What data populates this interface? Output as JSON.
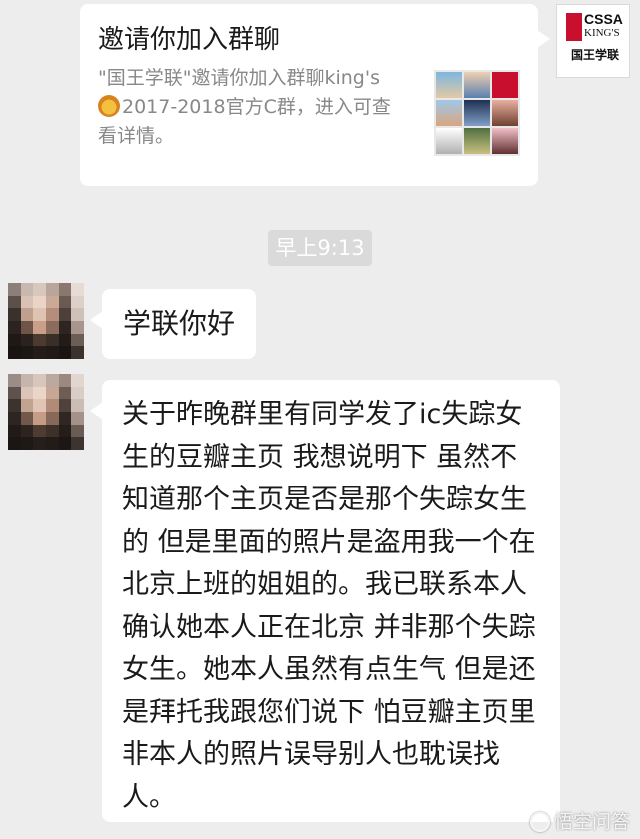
{
  "invite_card": {
    "title": "邀请你加入群聊",
    "description_line1": "\"国王学联\"邀请你加入群聊king's",
    "description_line2": "2017-2018官方C群，进入可查",
    "description_line3": "看详情。"
  },
  "self_avatar": {
    "logo_text": "CSSA",
    "logo_subtext": "KING'S",
    "logo_chinese": "国王学联",
    "brand_color": "#c8102e"
  },
  "timestamp": "早上9:13",
  "messages": [
    {
      "text": "学联你好"
    },
    {
      "text": "关于昨晚群里有同学发了ic失踪女生的豆瓣主页 我想说明下 虽然不知道那个主页是否是那个失踪女生的 但是里面的照片是盗用我一个在北京上班的姐姐的。我已联系本人确认她本人正在北京 并非那个失踪女生。她本人虽然有点生气 但是还是拜托我跟您们说下 怕豆瓣主页里非本人的照片误导别人也耽误找人。"
    }
  ],
  "watermark": "悟空问答",
  "colors": {
    "background": "#ededed",
    "bubble": "#ffffff",
    "timestamp_bg": "#dadada"
  }
}
